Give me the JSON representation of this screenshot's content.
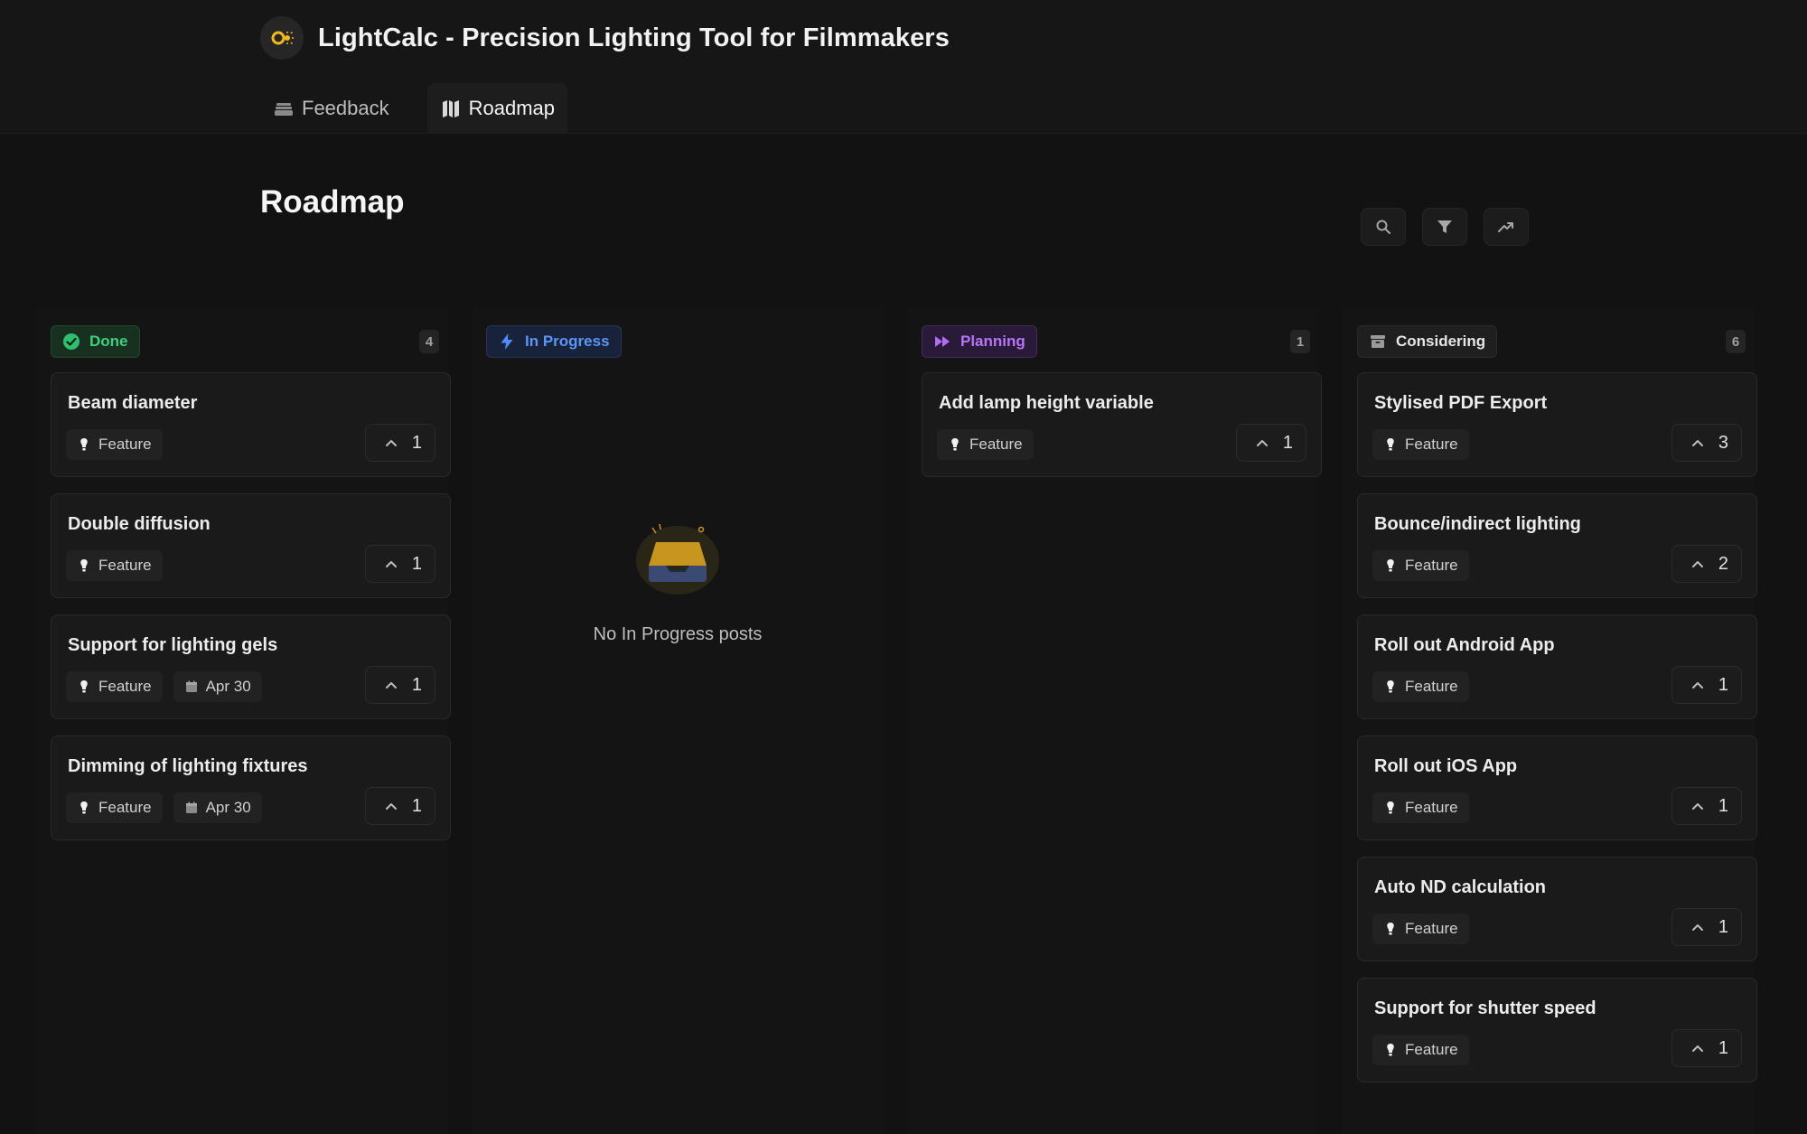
{
  "app": {
    "title": "LightCalc - Precision Lighting Tool for Filmmakers"
  },
  "tabs": [
    {
      "label": "Feedback",
      "icon": "inbox-stack-icon",
      "active": false
    },
    {
      "label": "Roadmap",
      "icon": "roadmap-icon",
      "active": true
    }
  ],
  "page": {
    "title": "Roadmap"
  },
  "tools": [
    {
      "icon": "search-icon"
    },
    {
      "icon": "filter-icon"
    },
    {
      "icon": "trending-icon"
    }
  ],
  "columns": [
    {
      "label": "Done",
      "count": "4",
      "icon": "check-circle-icon",
      "color": "#2fbf71",
      "cards": [
        {
          "title": "Beam diameter",
          "tag": "Feature",
          "date": "",
          "votes": "1"
        },
        {
          "title": "Double diffusion",
          "tag": "Feature",
          "date": "",
          "votes": "1"
        },
        {
          "title": "Support for lighting gels",
          "tag": "Feature",
          "date": "Apr 30",
          "votes": "1"
        },
        {
          "title": "Dimming of lighting fixtures",
          "tag": "Feature",
          "date": "Apr 30",
          "votes": "1"
        }
      ]
    },
    {
      "label": "In Progress",
      "count": "",
      "icon": "bolt-icon",
      "color": "#4f8ef7",
      "empty_text": "No In Progress posts",
      "cards": []
    },
    {
      "label": "Planning",
      "count": "1",
      "icon": "fast-forward-icon",
      "color": "#b36cf5",
      "cards": [
        {
          "title": "Add lamp height variable",
          "tag": "Feature",
          "date": "",
          "votes": "1"
        }
      ]
    },
    {
      "label": "Considering",
      "count": "6",
      "icon": "archive-box-icon",
      "color": "#c9c9c9",
      "cards": [
        {
          "title": "Stylised PDF Export",
          "tag": "Feature",
          "date": "",
          "votes": "3"
        },
        {
          "title": "Bounce/indirect lighting",
          "tag": "Feature",
          "date": "",
          "votes": "2"
        },
        {
          "title": "Roll out Android App",
          "tag": "Feature",
          "date": "",
          "votes": "1"
        },
        {
          "title": "Roll out iOS App",
          "tag": "Feature",
          "date": "",
          "votes": "1"
        },
        {
          "title": "Auto ND calculation",
          "tag": "Feature",
          "date": "",
          "votes": "1"
        },
        {
          "title": "Support for shutter speed",
          "tag": "Feature",
          "date": "",
          "votes": "1"
        }
      ]
    }
  ]
}
